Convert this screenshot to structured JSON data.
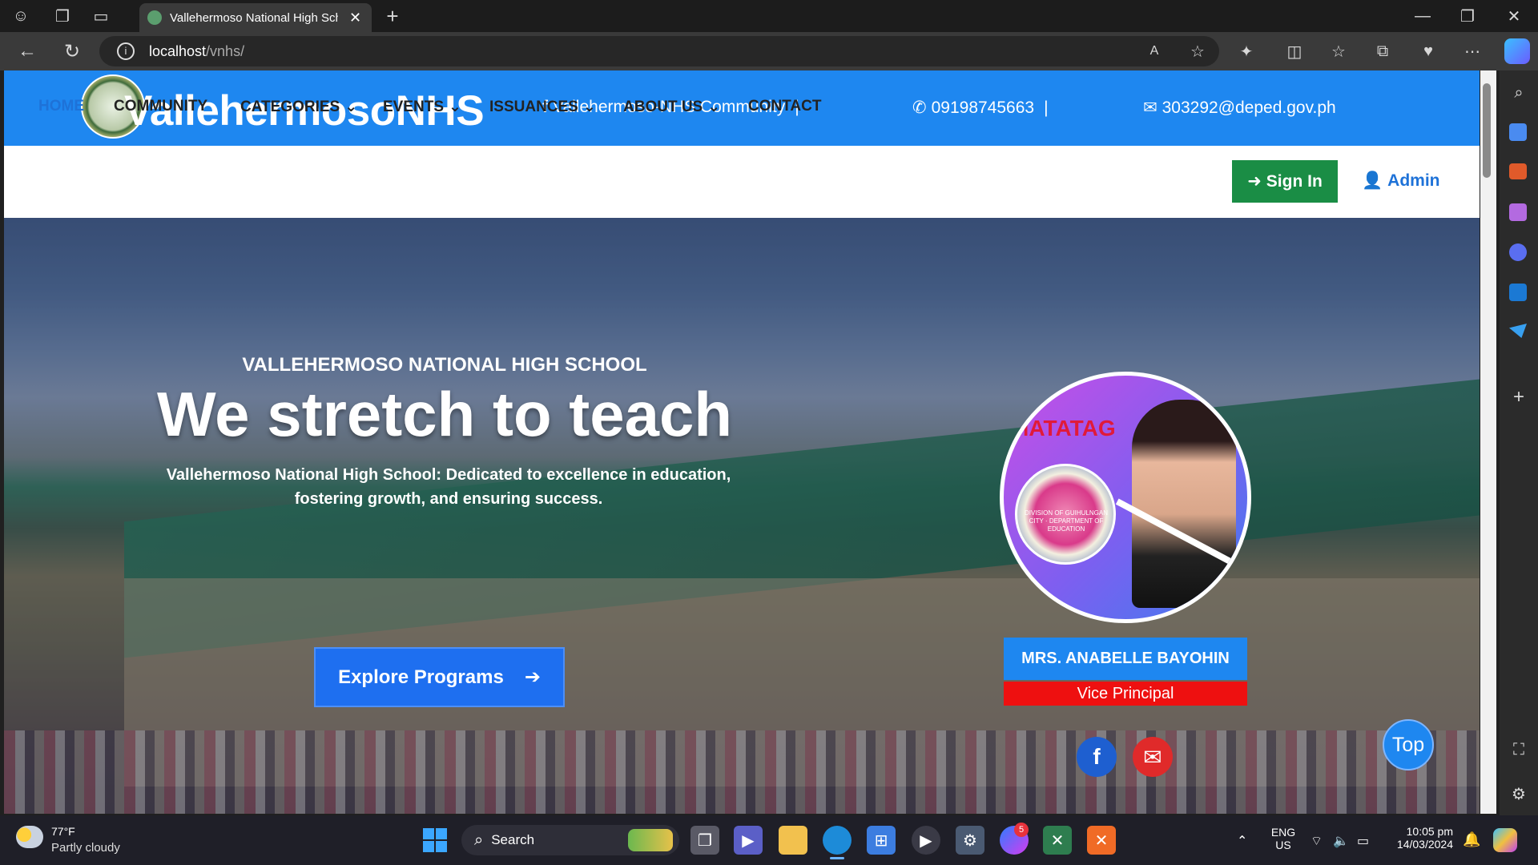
{
  "browser": {
    "tab_title": "Vallehermoso National High Sch",
    "url": "localhost/vnhs/",
    "url_host": "localhost",
    "url_path": "/vnhs/"
  },
  "site": {
    "brand": "VallehermosoNHS",
    "facebook": "Vallehermoso-NHS Community",
    "phone": "09198745663",
    "email": "303292@deped.gov.ph",
    "nav": {
      "home": "HOME",
      "community": "COMMUNITY",
      "categories": "CATEGORIES",
      "events": "EVENTS",
      "issuances": "ISSUANCES",
      "about": "ABOUT US",
      "contact": "CONTACT"
    },
    "sign_in": "Sign In",
    "admin": "Admin"
  },
  "hero": {
    "subtitle": "VALLEHERMOSO NATIONAL HIGH SCHOOL",
    "title": "We stretch to teach",
    "description_line1": "Vallehermoso National High School: Dedicated to excellence in education,",
    "description_line2": "fostering growth, and ensuring success.",
    "cta": "Explore Programs",
    "profile_name": "MRS. ANABELLE BAYOHIN",
    "profile_role": "Vice Principal",
    "photo_text": "MATATAG",
    "seal_text": "DIVISION OF GUIHULNGAN CITY · DEPARTMENT OF EDUCATION"
  },
  "top_button": "Top",
  "taskbar": {
    "temperature": "77°F",
    "weather": "Partly cloudy",
    "search": "Search",
    "lang1": "ENG",
    "lang2": "US",
    "time": "10:05 pm",
    "date": "14/03/2024",
    "messenger_badge": "5"
  },
  "colors": {
    "primary_blue": "#1e87f0",
    "signin_green": "#1a8d45",
    "role_red": "#ee1010",
    "email_red": "#e02a2a"
  }
}
